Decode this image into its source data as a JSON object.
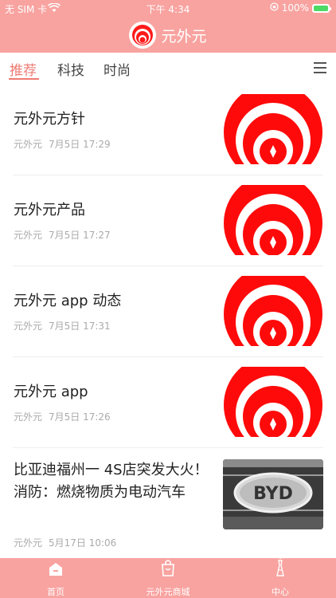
{
  "status": {
    "carrier": "无 SIM 卡",
    "time": "下午 4:34",
    "battery": "100%"
  },
  "app": {
    "title": "元外元"
  },
  "tabs": [
    {
      "label": "推荐"
    },
    {
      "label": "科技"
    },
    {
      "label": "时尚"
    }
  ],
  "articles": [
    {
      "title": "元外元方针",
      "source": "元外元",
      "date": "7月5日 17:29"
    },
    {
      "title": "元外元产品",
      "source": "元外元",
      "date": "7月5日 17:27"
    },
    {
      "title": "元外元 app 动态",
      "source": "元外元",
      "date": "7月5日 17:31"
    },
    {
      "title": "元外元 app",
      "source": "元外元",
      "date": "7月5日 17:26"
    },
    {
      "title": "比亚迪福州一 4S店突发大火！消防：燃烧物质为电动汽车",
      "source": "元外元",
      "date": "5月17日 10:06",
      "car_badge": "BYD"
    }
  ],
  "bottom_nav": [
    {
      "label": "首页"
    },
    {
      "label": "元外元商城"
    },
    {
      "label": "中心"
    }
  ],
  "colors": {
    "brand": "#f8a3a0",
    "accent": "#f07a73",
    "logo_red": "#ff1a1a"
  }
}
